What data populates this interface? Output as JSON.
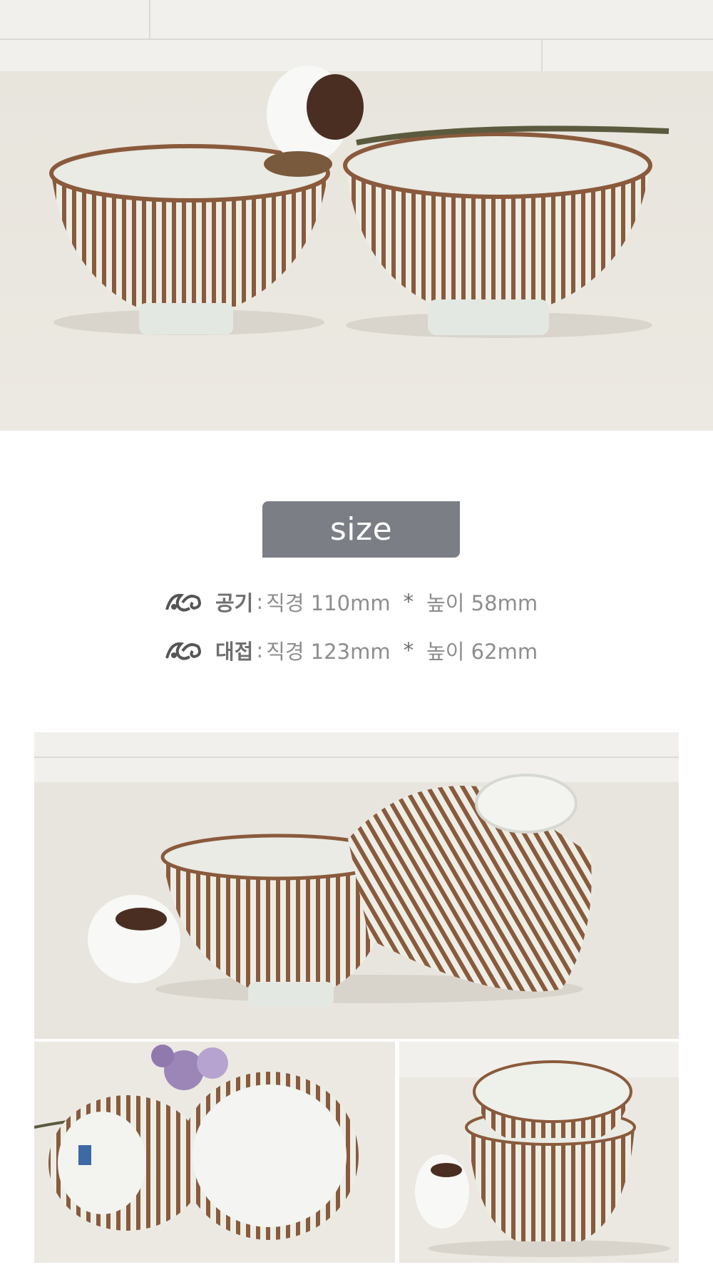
{
  "size_section": {
    "badge": "size",
    "specs": [
      {
        "name": "공기",
        "sep": ":",
        "diameter": "직경 110mm",
        "mult": "*",
        "height": "높이 58mm"
      },
      {
        "name": "대접",
        "sep": ":",
        "diameter": "직경 123mm",
        "mult": "*",
        "height": "높이 62mm"
      }
    ]
  },
  "photos": [
    {
      "name": "two striped bowls with cotton flower"
    },
    {
      "name": "upright bowl and upside-down bowl with cotton flower"
    },
    {
      "name": "bowls with purple flowers"
    },
    {
      "name": "stacked bowls with cotton flower"
    }
  ],
  "colors": {
    "badge": "#7b7e84",
    "text": "#8d8d8d",
    "stripe": "#8a5a3c",
    "glaze": "#eceee6"
  }
}
